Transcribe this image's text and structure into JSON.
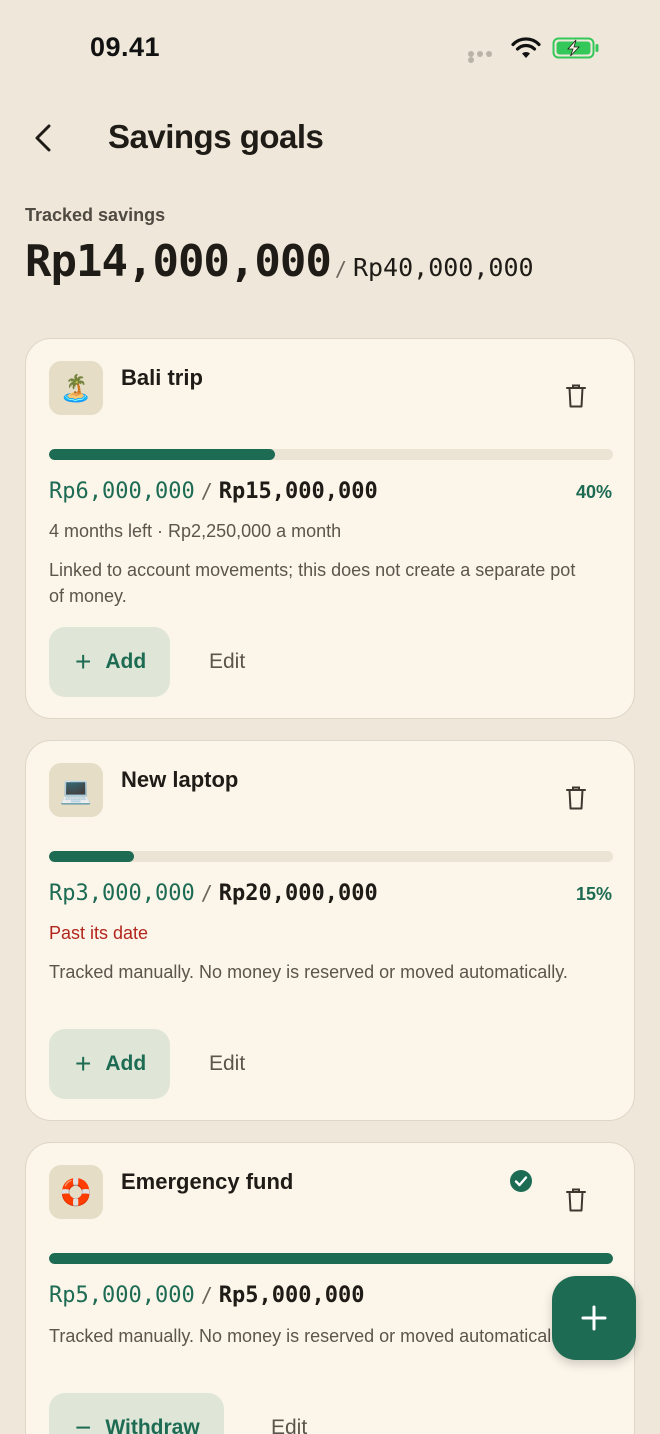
{
  "status_bar": {
    "time": "09.41"
  },
  "header": {
    "title": "Savings goals"
  },
  "summary": {
    "label": "Tracked savings",
    "total": "Rp14,000,000",
    "separator": "/",
    "target": "Rp40,000,000"
  },
  "goals": [
    {
      "emoji": "🏝️",
      "name": "Bali trip",
      "saved": "Rp6,000,000",
      "separator": "/",
      "target": "Rp15,000,000",
      "percent_label": "40%",
      "progress": 0.4,
      "meta": "4 months left · Rp2,250,000 a month",
      "note": "Linked to account movements; this does not create a separate pot of money.",
      "action_label": "Add",
      "action_glyph": "+",
      "edit_label": "Edit"
    },
    {
      "emoji": "💻",
      "name": "New laptop",
      "saved": "Rp3,000,000",
      "separator": "/",
      "target": "Rp20,000,000",
      "percent_label": "15%",
      "progress": 0.15,
      "meta": "Past its date",
      "note": "Tracked manually. No money is reserved or moved automatically.",
      "action_label": "Add",
      "action_glyph": "+",
      "edit_label": "Edit"
    },
    {
      "emoji": "🛟",
      "name": "Emergency fund",
      "saved": "Rp5,000,000",
      "separator": "/",
      "target": "Rp5,000,000",
      "percent_label": "",
      "progress": 1.0,
      "completed": true,
      "note": "Tracked manually. No money is reserved or moved automatically.",
      "action_label": "Withdraw",
      "action_glyph": "−",
      "edit_label": "Edit"
    }
  ],
  "colors": {
    "accent": "#1d6b53",
    "background": "#efe8da",
    "card": "#fbf5ea",
    "overdue": "#b3261e"
  },
  "icons": {
    "back": "chevron-left-icon",
    "delete": "trash-icon",
    "complete": "check-circle-icon",
    "fab": "plus-icon"
  }
}
